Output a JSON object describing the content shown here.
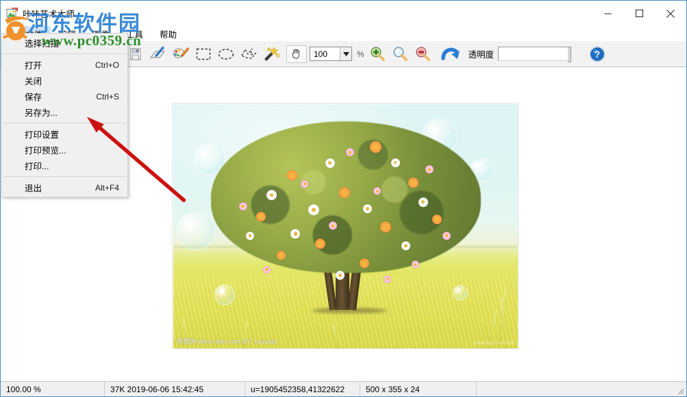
{
  "window": {
    "title": "咔咔艺术大师",
    "app_icon": "art-master-icon",
    "controls": {
      "minimize": "minimize-button",
      "maximize": "maximize-button",
      "close": "close-button"
    }
  },
  "menubar": {
    "items": [
      {
        "label": "文件",
        "active": true
      },
      {
        "label": "编辑",
        "active": false
      },
      {
        "label": "图像",
        "active": false
      },
      {
        "label": "工具",
        "active": false
      },
      {
        "label": "帮助",
        "active": false
      }
    ]
  },
  "file_menu": {
    "items": [
      {
        "type": "item",
        "label": "选择扫描",
        "accel": ""
      },
      {
        "type": "separator"
      },
      {
        "type": "item",
        "label": "打开",
        "accel": "Ctrl+O"
      },
      {
        "type": "item",
        "label": "关闭",
        "accel": ""
      },
      {
        "type": "item",
        "label": "保存",
        "accel": "Ctrl+S"
      },
      {
        "type": "item",
        "label": "另存为...",
        "accel": ""
      },
      {
        "type": "separator"
      },
      {
        "type": "item",
        "label": "打印设置",
        "accel": ""
      },
      {
        "type": "item",
        "label": "打印预览...",
        "accel": ""
      },
      {
        "type": "item",
        "label": "打印...",
        "accel": ""
      },
      {
        "type": "separator"
      },
      {
        "type": "item",
        "label": "退出",
        "accel": "Alt+F4"
      }
    ]
  },
  "toolbar": {
    "buttons": [
      {
        "icon": "save-document-icon",
        "title": "保存"
      },
      {
        "icon": "pen-tablet-icon",
        "title": "绘图"
      },
      {
        "icon": "paint-palette-icon",
        "title": "调色板"
      },
      {
        "icon": "rectangle-select-icon",
        "title": "矩形选择"
      },
      {
        "icon": "ellipse-select-icon",
        "title": "椭圆选择"
      },
      {
        "icon": "lasso-select-icon",
        "title": "套索选择"
      },
      {
        "icon": "magic-wand-icon",
        "title": "魔术棒"
      },
      {
        "icon": "hand-pan-icon",
        "title": "抓手"
      },
      {
        "icon": "zoom-in-icon",
        "title": "放大"
      },
      {
        "icon": "zoom-actual-icon",
        "title": "实际大小"
      },
      {
        "icon": "zoom-out-icon",
        "title": "缩小"
      },
      {
        "icon": "rotate-icon",
        "title": "旋转"
      },
      {
        "icon": "help-icon",
        "title": "帮助"
      }
    ],
    "zoom": {
      "value": "100",
      "percent_symbol": "%"
    },
    "transparency": {
      "label": "透明度",
      "slider_value": ""
    }
  },
  "canvas": {
    "image": {
      "alt": "flowering-tree-over-wheat-field",
      "watermark_left": "昵图网 www.nipic.com   BY: navuata",
      "watermark_right": "www.nipic.com/859"
    }
  },
  "overlay_watermarks": {
    "site_cn": "河东软件园",
    "site_url": "www.pc0359.cn",
    "logo": "site-logo-icon"
  },
  "statusbar": {
    "zoom": "100.00 %",
    "file_info": "37K 2019-06-06 15:42:45",
    "coords": "u=1905452358,41322622",
    "dimensions": "500 x 355 x 24",
    "grip": "resize-grip-icon"
  },
  "colors": {
    "window_border": "#4a90c2",
    "toolbar_bg": "#f2f2f2",
    "menu_highlight": "#cce4f7",
    "annotation_red": "#cc1111",
    "watermark_blue": "#2a7fd4",
    "watermark_green": "#1f8a1f"
  }
}
